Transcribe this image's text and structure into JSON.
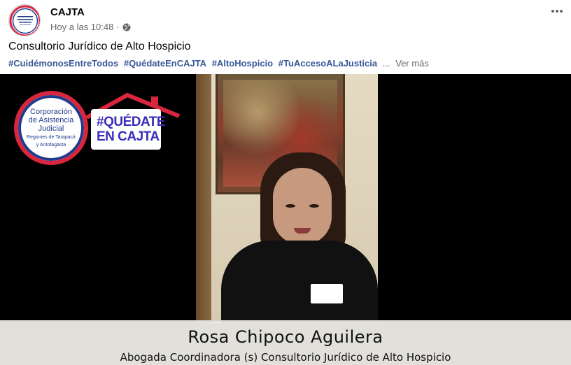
{
  "post": {
    "page_name": "CAJTA",
    "timestamp": "Hoy a las 10:48",
    "separator": "·",
    "title": "Consultorio Jurídico de Alto Hospicio",
    "hashtags": [
      "#CuidémonosEntreTodos",
      "#QuédateEnCAJTA",
      "#AltoHospicio",
      "#TuAccesoALaJusticia"
    ],
    "ellipsis": "...",
    "see_more": "Ver más",
    "avatar_text": [
      "Corporación de Asistencia Judicial",
      "Regiones de Tarapacá y Antofagasta"
    ]
  },
  "video": {
    "logo": {
      "line1": "Corporación",
      "line2": "de Asistencia",
      "line3": "Judicial",
      "line4": "Regiones de Tarapacá",
      "line5": "y Antofagasta"
    },
    "campaign": {
      "line1": "#QUÉDATE",
      "line2": "EN CAJTA"
    },
    "lower_third": {
      "name": "Rosa Chipoco Aguilera",
      "role": "Abogada Coordinadora (s) Consultorio Jurídico de Alto Hospicio"
    }
  },
  "colors": {
    "link": "#385898",
    "secondary_text": "#65676b",
    "brand_red": "#d7263d",
    "brand_blue": "#1f3b8c",
    "campaign_purple": "#3b2db8"
  },
  "icons": {
    "globe": "globe-icon",
    "more": "more-icon"
  }
}
